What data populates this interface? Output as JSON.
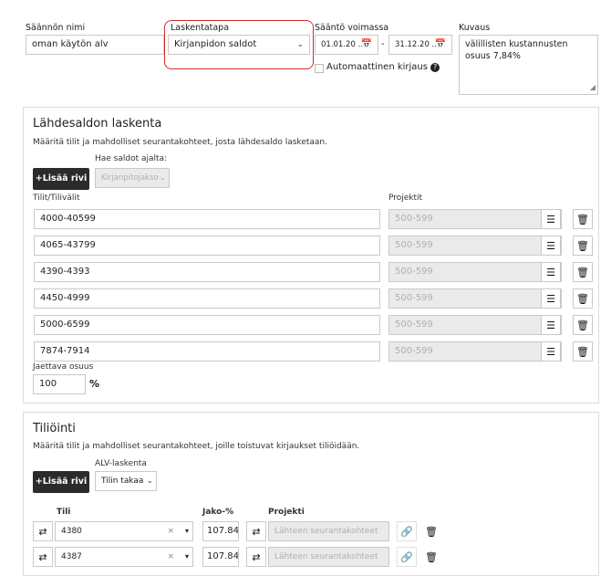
{
  "rule": {
    "name_label": "Säännön nimi",
    "name_value": "oman käytön alv",
    "method_label": "Laskentatapa",
    "method_value": "Kirjanpidon saldot",
    "validity_label": "Sääntö voimassa",
    "valid_from": "01.01.20 ...",
    "valid_sep": "-",
    "valid_to": "31.12.20 ...",
    "auto_label": "Automaattinen kirjaus",
    "desc_label": "Kuvaus",
    "desc_value": "välillisten kustannusten osuus 7,84%"
  },
  "source": {
    "title": "Lähdesaldon laskenta",
    "subtitle": "Määritä tilit ja mahdolliset seurantakohteet, josta lähdesaldo lasketaan.",
    "fetch_label": "Hae saldot ajalta:",
    "add_button": "+Lisää rivi",
    "period_select": "Kirjanpitojakso",
    "accounts_header": "Tilit/Tilivälit",
    "projects_header": "Projektit",
    "rows": [
      {
        "account": "4000-40599",
        "project": "500-599"
      },
      {
        "account": "4065-43799",
        "project": "500-599"
      },
      {
        "account": "4390-4393",
        "project": "500-599"
      },
      {
        "account": "4450-4999",
        "project": "500-599"
      },
      {
        "account": "5000-6599",
        "project": "500-599"
      },
      {
        "account": "7874-7914",
        "project": "500-599"
      }
    ],
    "share_label": "Jaettava osuus",
    "share_value": "100",
    "share_unit": "%"
  },
  "posting": {
    "title": "Tiliöinti",
    "subtitle": "Määritä tilit ja mahdolliset seurantakohteet, joille toistuvat kirjaukset tiliöidään.",
    "vat_label": "ALV-laskenta",
    "add_button": "+Lisää rivi",
    "vat_select": "Tilin takaa",
    "col_account": "Tili",
    "col_share": "Jako-%",
    "col_project": "Projekti",
    "rows": [
      {
        "account": "4380",
        "share": "107.84",
        "project_placeholder": "Lähteen seurantakohteet"
      },
      {
        "account": "4387",
        "share": "107.84",
        "project_placeholder": "Lähteen seurantakohteet"
      }
    ]
  }
}
